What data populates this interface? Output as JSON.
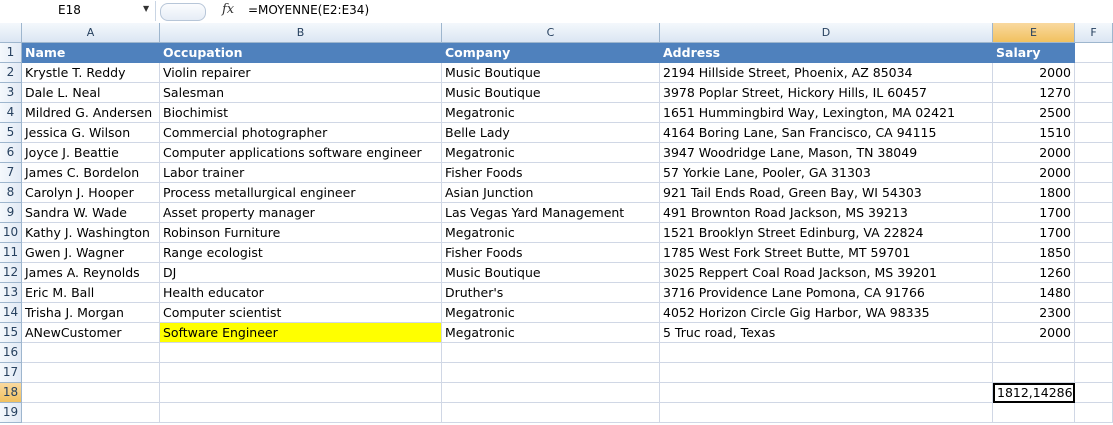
{
  "formula_bar": {
    "name_box": "E18",
    "fx_label": "fx",
    "formula": "=MOYENNE(E2:E34)"
  },
  "columns": [
    "A",
    "B",
    "C",
    "D",
    "E",
    "F"
  ],
  "rows": [
    [
      "Name",
      "Occupation",
      "Company",
      "Address",
      "Salary"
    ],
    [
      "Krystle T. Reddy",
      "Violin repairer",
      "Music Boutique",
      "2194 Hillside Street, Phoenix, AZ 85034",
      "2000"
    ],
    [
      "Dale L. Neal",
      "Salesman",
      "Music Boutique",
      "3978 Poplar Street, Hickory Hills, IL 60457",
      "1270"
    ],
    [
      "Mildred G. Andersen",
      "Biochimist",
      "Megatronic",
      "1651 Hummingbird Way, Lexington, MA 02421",
      "2500"
    ],
    [
      "Jessica G. Wilson",
      "Commercial photographer",
      "Belle Lady",
      "4164 Boring Lane, San Francisco, CA 94115",
      "1510"
    ],
    [
      "Joyce J. Beattie",
      "Computer applications software engineer",
      "Megatronic",
      "3947 Woodridge Lane, Mason, TN 38049",
      "2000"
    ],
    [
      "James C. Bordelon",
      "Labor trainer",
      "Fisher Foods",
      "57 Yorkie Lane, Pooler, GA 31303",
      "2000"
    ],
    [
      "Carolyn J. Hooper",
      "Process metallurgical engineer",
      "Asian Junction",
      "921 Tail Ends Road, Green Bay, WI 54303",
      "1800"
    ],
    [
      "Sandra W. Wade",
      "Asset property manager",
      "Las Vegas Yard Management",
      "491 Brownton Road Jackson, MS 39213",
      "1700"
    ],
    [
      "Kathy J. Washington",
      "Robinson Furniture",
      "Megatronic",
      "1521 Brooklyn Street Edinburg, VA 22824",
      "1700"
    ],
    [
      "Gwen J. Wagner",
      "Range ecologist",
      "Fisher Foods",
      "1785 West Fork Street Butte, MT 59701",
      "1850"
    ],
    [
      "James A. Reynolds",
      "DJ",
      "Music Boutique",
      "3025 Reppert Coal Road Jackson, MS 39201",
      "1260"
    ],
    [
      "Eric M. Ball",
      "Health educator",
      "Druther's",
      "3716 Providence Lane Pomona, CA 91766",
      "1480"
    ],
    [
      "Trisha J. Morgan",
      "Computer scientist",
      "Megatronic",
      "4052 Horizon Circle Gig Harbor, WA 98335",
      "2300"
    ],
    [
      "ANewCustomer",
      "Software Engineer",
      "Megatronic",
      "5 Truc road, Texas",
      "2000"
    ],
    [
      "",
      "",
      "",
      "",
      ""
    ],
    [
      "",
      "",
      "",
      "",
      ""
    ],
    [
      "",
      "",
      "",
      "",
      "1812,14286"
    ],
    [
      "",
      "",
      "",
      "",
      ""
    ]
  ],
  "row_numbers": [
    "1",
    "2",
    "3",
    "4",
    "5",
    "6",
    "7",
    "8",
    "9",
    "10",
    "11",
    "12",
    "13",
    "14",
    "15",
    "16",
    "17",
    "18",
    "19"
  ],
  "active_cell": "E18",
  "highlight_cell": "B15",
  "colors": {
    "header_fill": "#4f81bd",
    "highlight_fill": "#ffff00"
  }
}
